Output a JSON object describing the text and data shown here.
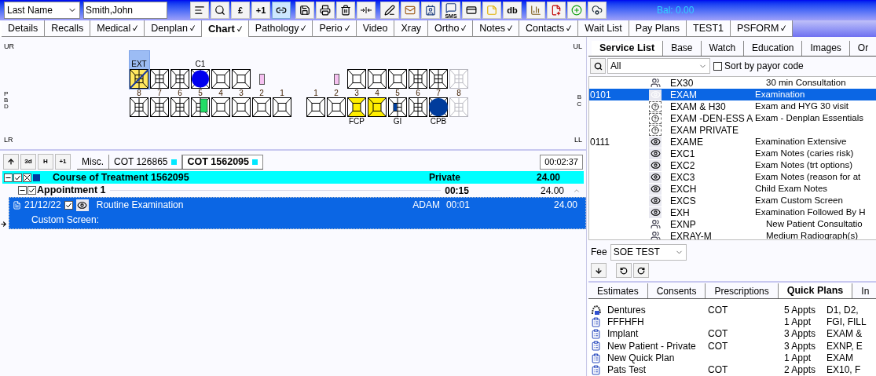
{
  "patient_search": {
    "field": "Last Name",
    "value": "Smith,John"
  },
  "toolbar": [
    [
      {
        "kind": "icon",
        "selected": false
      },
      {
        "kind": "icon",
        "selected": false
      },
      {
        "kind": "text",
        "label": "£",
        "selected": false
      },
      {
        "kind": "text",
        "label": "+1",
        "selected": false
      },
      {
        "kind": "icon",
        "selected": true
      }
    ],
    [
      {
        "kind": "icon",
        "selected": false
      },
      {
        "kind": "icon",
        "selected": false
      },
      {
        "kind": "icon",
        "selected": false
      },
      {
        "kind": "icon",
        "selected": false
      }
    ],
    [
      {
        "kind": "icon",
        "selected": false
      },
      {
        "kind": "icon",
        "selected": false
      },
      {
        "kind": "icon",
        "selected": false
      },
      {
        "kind": "icon-text",
        "label": "SMS",
        "selected": false
      },
      {
        "kind": "icon",
        "selected": false
      },
      {
        "kind": "icon",
        "selected": false
      },
      {
        "kind": "text",
        "label": "db",
        "selected": false
      }
    ],
    [
      {
        "kind": "icon",
        "selected": false
      },
      {
        "kind": "icon",
        "selected": false
      },
      {
        "kind": "icon",
        "selected": false
      },
      {
        "kind": "icon",
        "selected": false
      }
    ]
  ],
  "balance": "Bal: 0.00",
  "tabs": [
    {
      "label": "Details",
      "ticked": false,
      "selected": false
    },
    {
      "label": "Recalls",
      "ticked": false,
      "selected": false
    },
    {
      "label": "Medical",
      "ticked": true,
      "selected": false
    },
    {
      "label": "Denplan",
      "ticked": true,
      "selected": false
    },
    {
      "label": "Chart",
      "ticked": true,
      "selected": true
    },
    {
      "label": "Pathology",
      "ticked": true,
      "selected": false
    },
    {
      "label": "Perio",
      "ticked": true,
      "selected": false
    },
    {
      "label": "Video",
      "ticked": false,
      "selected": false
    },
    {
      "label": "Xray",
      "ticked": false,
      "selected": false
    },
    {
      "label": "Ortho",
      "ticked": true,
      "selected": false
    },
    {
      "label": "Notes",
      "ticked": true,
      "selected": false
    },
    {
      "label": "Contacts",
      "ticked": true,
      "selected": false
    },
    {
      "label": "Wait List",
      "ticked": false,
      "selected": false
    },
    {
      "label": "Pay Plans",
      "ticked": false,
      "selected": false
    },
    {
      "label": "TEST1",
      "ticked": false,
      "selected": false
    },
    {
      "label": "PSFORM",
      "ticked": true,
      "selected": false
    }
  ],
  "chart": {
    "corner_labels": [
      "UR",
      "UL",
      "LR",
      "LL"
    ],
    "left_markers": [
      "P",
      "B",
      "D"
    ],
    "right_markers": [
      "B",
      "C"
    ],
    "sides": [
      {
        "columns": [
          {
            "number": "8",
            "upper": {
              "kind": "molar",
              "marking": {
                "kind": "extraction"
              },
              "label": "EXT",
              "selected": true
            },
            "lower": {
              "kind": "molar"
            }
          },
          {
            "number": "7",
            "upper": {
              "kind": "molar",
              "selected": false
            },
            "lower": {
              "kind": "molar"
            }
          },
          {
            "number": "6",
            "upper": {
              "kind": "molar",
              "selected": false
            },
            "lower": {
              "kind": "molar"
            }
          },
          {
            "number": "5",
            "upper": {
              "kind": "molar",
              "marking": {
                "kind": "crown"
              },
              "label": "C1",
              "selected": false
            },
            "lower": {
              "kind": "molar",
              "marking": {
                "kind": "side-filling"
              }
            }
          },
          {
            "number": "4",
            "upper": {
              "kind": "tooth",
              "selected": false
            },
            "lower": {
              "kind": "tooth"
            }
          },
          {
            "number": "3",
            "upper": {
              "kind": "tooth",
              "selected": false
            },
            "lower": {
              "kind": "tooth"
            }
          },
          {
            "number": "2",
            "upper": {
              "kind": "stub",
              "selected": false
            },
            "lower": {
              "kind": "tooth"
            }
          },
          {
            "number": "1",
            "upper": {
              "kind": "gap"
            },
            "lower": {
              "kind": "tooth"
            }
          }
        ]
      },
      {
        "columns": [
          {
            "number": "1",
            "upper": {
              "kind": "gap"
            },
            "lower": {
              "kind": "tooth"
            }
          },
          {
            "number": "2",
            "upper": {
              "kind": "stub",
              "selected": false
            },
            "lower": {
              "kind": "tooth"
            }
          },
          {
            "number": "3",
            "upper": {
              "kind": "tooth",
              "selected": false
            },
            "lower": {
              "kind": "tooth",
              "marking": {
                "kind": "bridge"
              },
              "label": "FCP"
            }
          },
          {
            "number": "4",
            "upper": {
              "kind": "tooth",
              "selected": false
            },
            "lower": {
              "kind": "tooth",
              "marking": {
                "kind": "inlay"
              }
            }
          },
          {
            "number": "5",
            "upper": {
              "kind": "tooth",
              "selected": false
            },
            "lower": {
              "kind": "molar",
              "marking": {
                "kind": "small-filling"
              },
              "label": "GI"
            }
          },
          {
            "number": "6",
            "upper": {
              "kind": "molar",
              "selected": false
            },
            "lower": {
              "kind": "molar"
            }
          },
          {
            "number": "7",
            "upper": {
              "kind": "molar",
              "selected": false
            },
            "lower": {
              "kind": "molar",
              "marking": {
                "kind": "oval"
              },
              "label": "CPB"
            }
          },
          {
            "number": "8",
            "upper": {
              "kind": "faded",
              "selected": false
            },
            "lower": {
              "kind": "faded"
            }
          }
        ]
      }
    ]
  },
  "treatment": {
    "buttons": [
      {
        "kind": "icon"
      },
      {
        "kind": "text",
        "label": "3d"
      },
      {
        "kind": "text",
        "label": "H"
      },
      {
        "kind": "text",
        "label": "+1"
      }
    ],
    "tabs": [
      {
        "label": "Misc.",
        "flag": false,
        "selected": false
      },
      {
        "label": "COT 126865",
        "flag": true,
        "selected": false
      },
      {
        "label": "COT 1562095",
        "flag": true,
        "selected": true
      }
    ],
    "timer": "00:02:37",
    "course": {
      "title": "Course of Treatment 1562095",
      "payor": "Private",
      "total": "24.00",
      "expanded": true,
      "checked": true
    },
    "appointment": {
      "title": "Appointment 1",
      "duration": "00:15",
      "total": "24.00",
      "expanded": true,
      "checked": true
    },
    "items": [
      {
        "date": "21/12/22",
        "checked": true,
        "name": "Routine Examination",
        "clinician": "ADAM",
        "time": "00:01",
        "fee": "24.00",
        "note": "Custom Screen:",
        "selected": true
      }
    ]
  },
  "service_panel": {
    "tabs": [
      {
        "label": "Service List",
        "selected": true
      },
      {
        "label": "Base",
        "selected": false
      },
      {
        "label": "Watch",
        "selected": false
      },
      {
        "label": "Education",
        "selected": false
      },
      {
        "label": "Images",
        "selected": false
      },
      {
        "label": "Or",
        "selected": false
      }
    ],
    "filter": "All",
    "sort_by_payor": {
      "label": "Sort by payor code",
      "checked": false
    },
    "rows": [
      {
        "code": "",
        "kind": "consult",
        "name": "EX30",
        "description": "30 min  Consultation",
        "selected": false
      },
      {
        "code": "0101",
        "kind": "eye",
        "name": "EXAM",
        "description": "Examination",
        "selected": true
      },
      {
        "code": "",
        "kind": "unknown",
        "name": "EXAM & H30",
        "description": "Exam and HYG 30 visit",
        "selected": false
      },
      {
        "code": "",
        "kind": "unknown",
        "name": "EXAM -DEN-ESS A",
        "description": "Exam - Denplan Essentials",
        "selected": false
      },
      {
        "code": "",
        "kind": "unknown",
        "name": "EXAM PRIVATE",
        "description": "",
        "selected": false
      },
      {
        "code": "0111",
        "kind": "eye",
        "name": "EXAME",
        "description": "Examination Extensive",
        "selected": false
      },
      {
        "code": "",
        "kind": "eye",
        "name": "EXC1",
        "description": "Exam Notes (caries risk)",
        "selected": false
      },
      {
        "code": "",
        "kind": "eye",
        "name": "EXC2",
        "description": "Exam Notes (trt options)",
        "selected": false
      },
      {
        "code": "",
        "kind": "eye",
        "name": "EXC3",
        "description": "Exam Notes (reason for at",
        "selected": false
      },
      {
        "code": "",
        "kind": "eye",
        "name": "EXCH",
        "description": "Child Exam Notes",
        "selected": false
      },
      {
        "code": "",
        "kind": "eye",
        "name": "EXCS",
        "description": "Exam Custom Screen",
        "selected": false
      },
      {
        "code": "",
        "kind": "eye",
        "name": "EXH",
        "description": "Examination Followed By H",
        "selected": false
      },
      {
        "code": "",
        "kind": "consult",
        "name": "EXNP",
        "description": "New Patient Consultatio",
        "selected": false
      },
      {
        "code": "",
        "kind": "consult",
        "name": "EXRAY-M",
        "description": "Medium Radiograph(s)",
        "selected": false
      }
    ],
    "fee_label": "Fee",
    "fee_schedule": "SOE TEST"
  },
  "plans_panel": {
    "tabs": [
      {
        "label": "Estimates",
        "selected": false
      },
      {
        "label": "Consents",
        "selected": false
      },
      {
        "label": "Prescriptions",
        "selected": false
      },
      {
        "label": "Quick Plans",
        "selected": true
      },
      {
        "label": "In",
        "selected": false
      }
    ],
    "rows": [
      {
        "kind": "denture",
        "name": "Dentures",
        "type": "COT",
        "appts": "5 Appts",
        "services": "D1, D2,"
      },
      {
        "kind": "plan",
        "name": "FFFHFH",
        "type": "",
        "appts": "1 Appt",
        "services": "FGI, FILL"
      },
      {
        "kind": "plan",
        "name": "Implant",
        "type": "COT",
        "appts": "3 Appts",
        "services": "EXAM &"
      },
      {
        "kind": "plan",
        "name": "New Patient - Private",
        "type": "COT",
        "appts": "3 Appts",
        "services": "EXNP, E"
      },
      {
        "kind": "plan",
        "name": "New Quick Plan",
        "type": "",
        "appts": "1 Appt",
        "services": "EXAM"
      },
      {
        "kind": "plan",
        "name": "Pats Test",
        "type": "COT",
        "appts": "2 Appts",
        "services": "EX10, F"
      }
    ]
  }
}
